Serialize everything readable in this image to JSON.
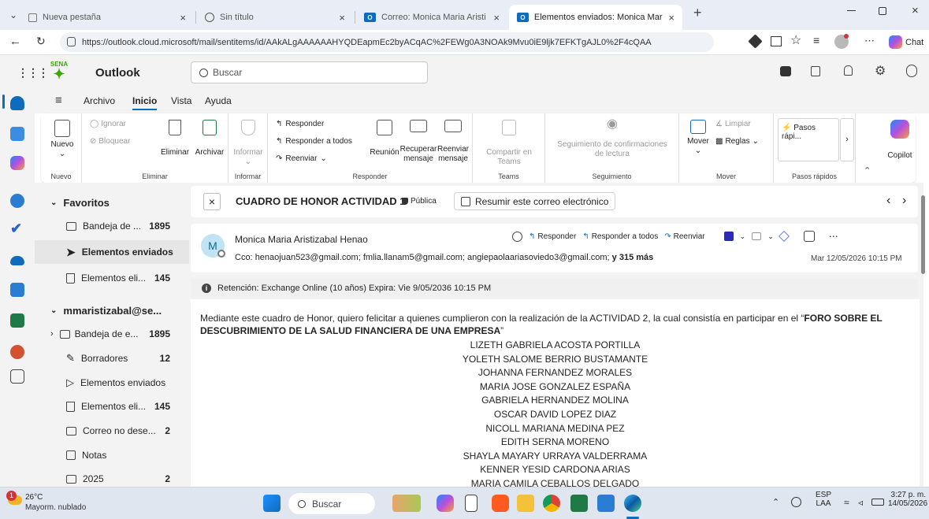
{
  "browser": {
    "tabs": [
      {
        "title": "Nueva pestaña",
        "active": false
      },
      {
        "title": "Sin título",
        "active": false
      },
      {
        "title": "Correo: Monica Maria Aristizabal H",
        "active": false
      },
      {
        "title": "Elementos enviados: Monica María",
        "active": true
      }
    ],
    "new_tab_icon": "plus-icon",
    "url": "https://outlook.cloud.microsoft/mail/sentitems/id/AAkALgAAAAAAHYQDEapmEc2byACqAC%2FEWg0A3NOAk9Mvu0iE9ljk7EFKTgAJL0%2F4cQAA",
    "chat_label": "Chat"
  },
  "outlook": {
    "app_name": "Outlook",
    "logo_text": "SENA",
    "search_placeholder": "Buscar"
  },
  "menu": {
    "items": [
      "Archivo",
      "Inicio",
      "Vista",
      "Ayuda"
    ],
    "active": "Inicio"
  },
  "ribbon": {
    "nuevo": {
      "label": "Nuevo",
      "group": "Nuevo"
    },
    "eliminar": {
      "ignorar": "Ignorar",
      "bloquear": "Bloquear",
      "eliminar": "Eliminar",
      "archivar": "Archivar",
      "group": "Eliminar"
    },
    "informar": {
      "label": "Informar",
      "group": "Informar"
    },
    "responder": {
      "responder": "Responder",
      "responder_todos": "Responder a todos",
      "reenviar": "Reenviar",
      "reunion": "Reunión",
      "recuperar": "Recuperar mensaje",
      "reenviar_msg": "Reenviar mensaje",
      "group": "Responder"
    },
    "teams": {
      "label": "Compartir en Teams",
      "group": "Teams"
    },
    "seguimiento": {
      "label": "Seguimiento de confirmaciones de lectura",
      "group": "Seguimiento"
    },
    "mover": {
      "mover": "Mover",
      "limpiar": "Limpiar",
      "reglas": "Reglas",
      "group": "Mover"
    },
    "pasos": {
      "label": "Pasos rápi...",
      "group": "Pasos rápidos"
    },
    "copilot": {
      "label": "Copilot"
    }
  },
  "folders": {
    "favoritos_label": "Favoritos",
    "favoritos": [
      {
        "label": "Bandeja de ...",
        "count": "1895",
        "icon": "inbox-icon"
      },
      {
        "label": "Elementos enviados",
        "count": "",
        "icon": "send-icon",
        "selected": true
      },
      {
        "label": "Elementos eli...",
        "count": "145",
        "icon": "trash-icon"
      }
    ],
    "account_label": "mmaristizabal@se...",
    "account": [
      {
        "label": "Bandeja de e...",
        "count": "1895",
        "icon": "inbox-icon"
      },
      {
        "label": "Borradores",
        "count": "12",
        "icon": "draft-icon"
      },
      {
        "label": "Elementos enviados",
        "count": "",
        "icon": "send-icon"
      },
      {
        "label": "Elementos eli...",
        "count": "145",
        "icon": "trash-icon"
      },
      {
        "label": "Correo no dese...",
        "count": "2",
        "icon": "junk-icon"
      },
      {
        "label": "Notas",
        "count": "",
        "icon": "note-icon"
      },
      {
        "label": "2025",
        "count": "2",
        "icon": "folder-icon"
      }
    ]
  },
  "message": {
    "subject": "CUADRO DE HONOR ACTIVIDAD 1",
    "visibility": "Pública",
    "summarize": "Resumir este correo electrónico",
    "sender": "Monica Maria Aristizabal Henao",
    "avatar_initial": "M",
    "cc_label": "Cco:",
    "cc": "henaojuan523@gmail.com;  fmlia.llanam5@gmail.com;  angiepaolaariasoviedo3@gmail.com;",
    "cc_more": "y 315 más",
    "date": "Mar 12/05/2026 10:15 PM",
    "reply": "Responder",
    "reply_all": "Responder a todos",
    "forward": "Reenviar",
    "retention": "Retención: Exchange Online (10 años) Expira: Vie 9/05/2036 10:15 PM",
    "body_intro": "Mediante este cuadro de Honor,  quiero felicitar a quienes cumplieron con la realización de la ACTIVIDAD 2,  la cual consistía en participar en el “",
    "body_bold": "FORO SOBRE EL DESCUBRIMIENTO DE LA SALUD FINANCIERA DE UNA EMPRESA",
    "body_end": "”",
    "names": [
      "LIZETH GABRIELA  ACOSTA PORTILLA",
      "YOLETH SALOME  BERRIO BUSTAMANTE",
      "JOHANNA  FERNANDEZ MORALES",
      "MARIA JOSE  GONZALEZ ESPAÑA",
      "GABRIELA  HERNANDEZ MOLINA",
      "OSCAR DAVID  LOPEZ DIAZ",
      "NICOLL MARIANA  MEDINA PEZ",
      "EDITH  SERNA MORENO",
      "SHAYLA MAYARY  URRAYA VALDERRAMA",
      "KENNER YESID  CARDONA ARIAS",
      "MARIA CAMILA  CEBALLOS DELGADO"
    ]
  },
  "taskbar": {
    "weather_temp": "26°C",
    "weather_desc": "Mayorm. nublado",
    "weather_badge": "1",
    "search": "Buscar",
    "lang1": "ESP",
    "lang2": "LAA",
    "time": "3:27 p. m.",
    "date": "14/05/2026"
  },
  "colors": {
    "accent": "#0f6cbd",
    "sena_green": "#39a900"
  }
}
